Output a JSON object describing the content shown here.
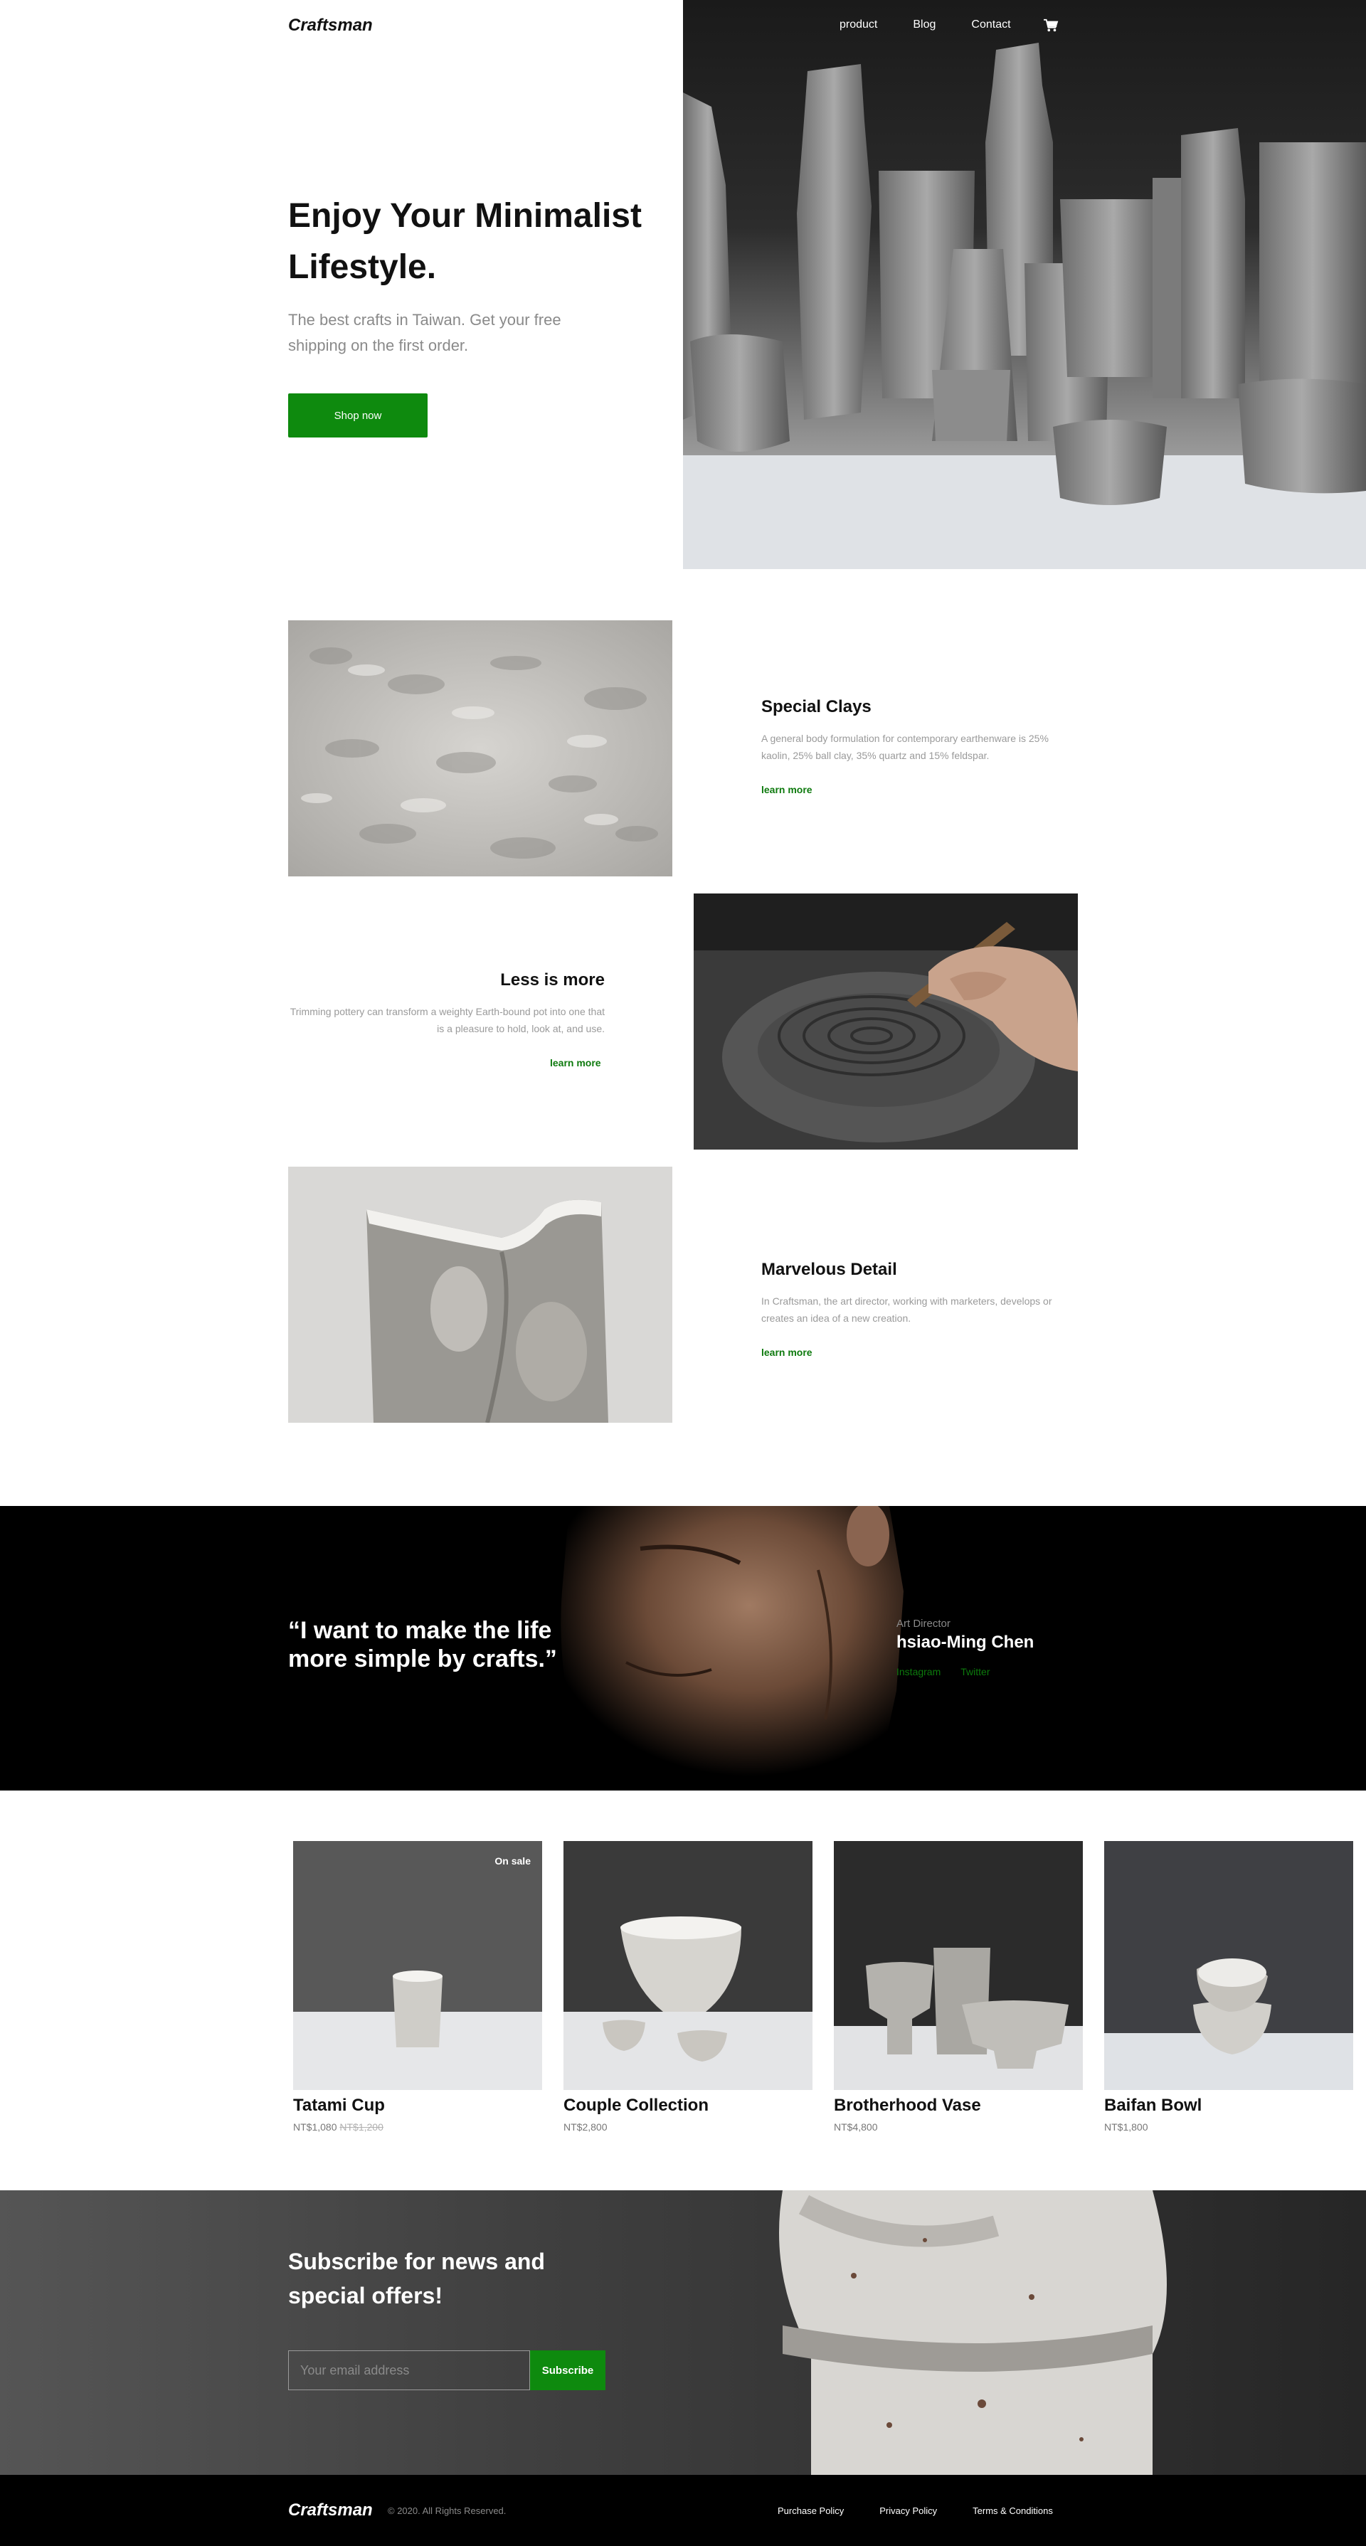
{
  "header": {
    "logo": "Craftsman",
    "nav": [
      "product",
      "Blog",
      "Contact"
    ],
    "cart_icon": "cart-icon"
  },
  "hero": {
    "title": "Enjoy Your Minimalist Lifestyle.",
    "subtitle": "The best crafts in Taiwan. Get your free shipping on the first order.",
    "cta": "Shop now"
  },
  "features": [
    {
      "title": "Special Clays",
      "text": "A general body formulation for contemporary earthenware is 25% kaolin, 25% ball clay, 35% quartz and 15% feldspar.",
      "link": "learn more"
    },
    {
      "title": "Less is more",
      "text": "Trimming pottery can transform a weighty Earth-bound pot into one that is a pleasure to hold, look at, and use.",
      "link": "learn more"
    },
    {
      "title": "Marvelous Detail",
      "text": "In Craftsman, the art director, working with marketers, develops or creates an idea of a new creation.",
      "link": "learn more"
    }
  ],
  "quote": {
    "text": "“I want to make the life more simple by crafts.”",
    "role": "Art Director",
    "name": "hsiao-Ming Chen",
    "links": [
      "Instagram",
      "Twitter"
    ]
  },
  "products": [
    {
      "name": "Tatami Cup",
      "price": "NT$1,080",
      "old_price": "NT$1,200",
      "badge": "On sale"
    },
    {
      "name": "Couple Collection",
      "price": "NT$2,800"
    },
    {
      "name": "Brotherhood Vase",
      "price": "NT$4,800"
    },
    {
      "name": "Baifan Bowl",
      "price": "NT$1,800"
    }
  ],
  "subscribe": {
    "title": "Subscribe for news and special offers!",
    "placeholder": "Your email address",
    "button": "Subscribe"
  },
  "footer": {
    "logo": "Craftsman",
    "copyright": "© 2020. All Rights Reserved.",
    "links": [
      "Purchase Policy",
      "Privacy Policy",
      "Terms & Conditions"
    ]
  },
  "colors": {
    "accent": "#0e8a0e",
    "text": "#111111",
    "muted": "#9a9a9a",
    "dark": "#000000"
  }
}
